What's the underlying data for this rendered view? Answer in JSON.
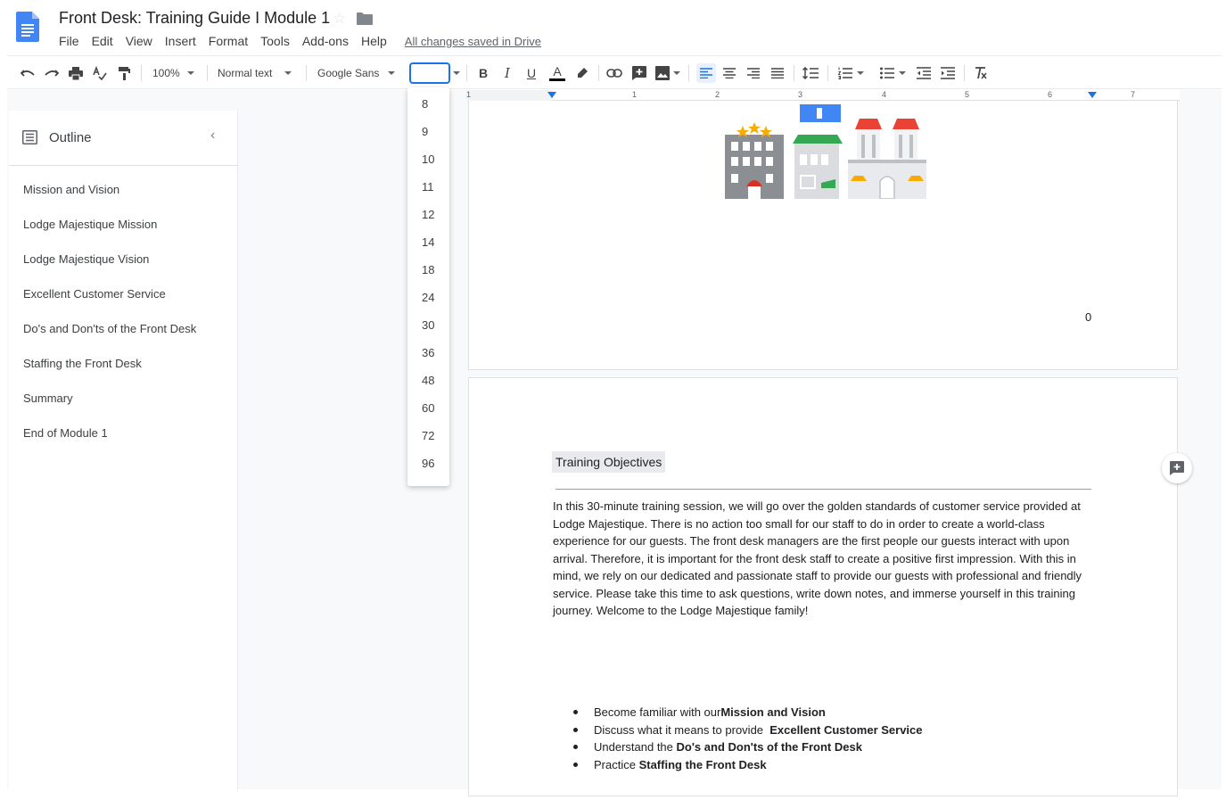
{
  "document": {
    "title": "Front Desk: Training Guide I Module 1",
    "saved_status": "All changes saved in Drive"
  },
  "menu": [
    "File",
    "Edit",
    "View",
    "Insert",
    "Format",
    "Tools",
    "Add-ons",
    "Help"
  ],
  "toolbar": {
    "zoom": "100%",
    "style": "Normal text",
    "font": "Google Sans",
    "font_size": "",
    "bold": "B",
    "italic": "I",
    "underline": "U",
    "text_color": "A"
  },
  "ruler": {
    "numbers": [
      "1",
      "1",
      "2",
      "3",
      "4",
      "5",
      "6",
      "7"
    ]
  },
  "font_size_options": [
    "8",
    "9",
    "10",
    "11",
    "12",
    "14",
    "18",
    "24",
    "30",
    "36",
    "48",
    "60",
    "72",
    "96"
  ],
  "outline": {
    "title": "Outline",
    "items": [
      "Mission and Vision",
      "Lodge Majestique Mission",
      "Lodge Majestique Vision",
      "Excellent Customer Service",
      "Do's and Don'ts of the Front Desk",
      "Staffing the Front Desk",
      "Summary",
      "End of Module 1"
    ]
  },
  "page1": {
    "page_number": "0"
  },
  "page2": {
    "heading": "Training Objectives",
    "paragraph": "In this 30-minute training session, we will  go over the golden standards of customer service provided at Lodge Majestique. There is no action too small for our staff to do in order to create a world-class experience for our guests. The front desk managers are the first people our guests interact with upon arrival. Therefore, it is important for the front desk staff to create a positive first impression. With this in mind, we rely on our dedicated and passionate staff to provide our guests with professional and friendly service. Please take this time to ask questions, write down notes, and immerse yourself in this training journey. Welcome to the Lodge Majestique family!",
    "bullets": [
      {
        "prefix": "Become familiar with our ",
        "bold": "Mission and Vision"
      },
      {
        "prefix": "Discuss what it means to provide  ",
        "bold": "Excellent Customer Service"
      },
      {
        "prefix": "Understand the ",
        "bold": "Do's and Don'ts of the Front Desk"
      },
      {
        "prefix": "Practice ",
        "bold": "Staffing the Front Desk"
      }
    ]
  },
  "colors": {
    "accent": "#1a73e8",
    "doc_icon": "#4285f4"
  }
}
